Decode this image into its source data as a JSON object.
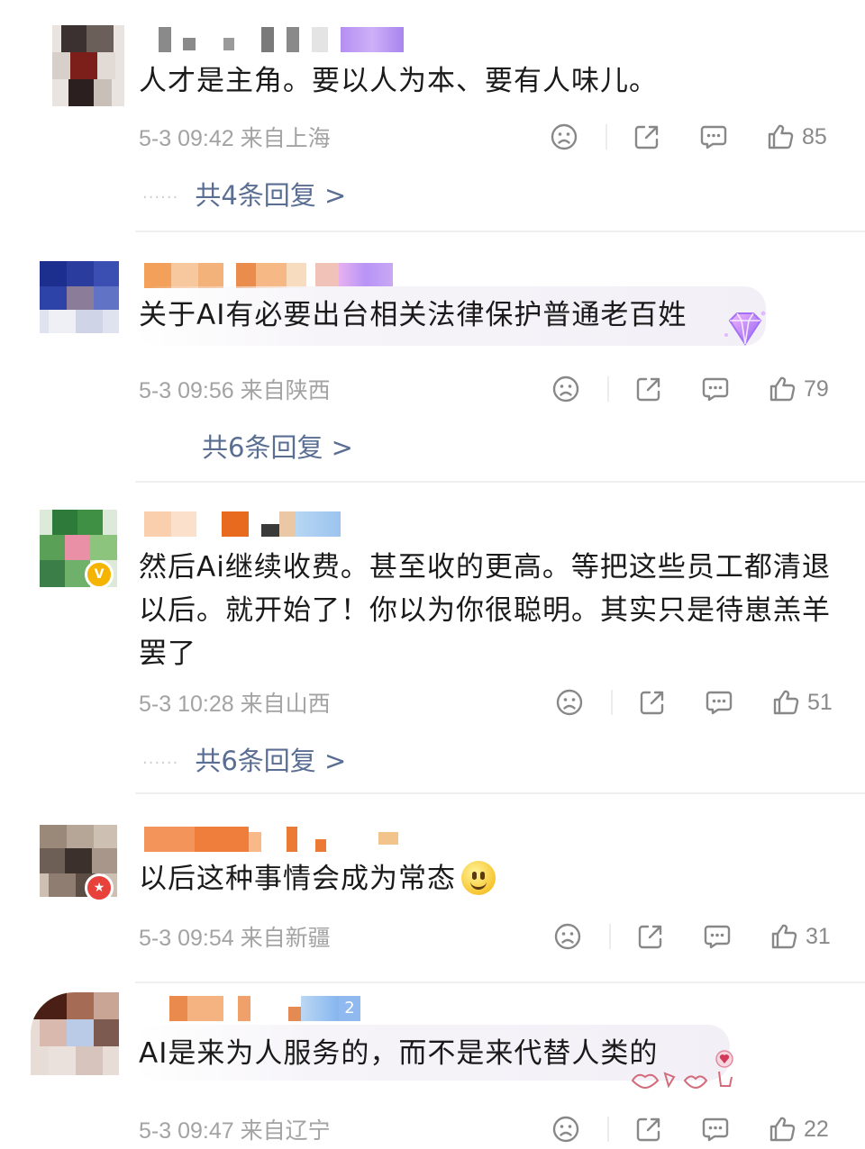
{
  "comments": [
    {
      "text": "人才是主角。要以人为本、要有人味儿。",
      "meta": "5-3 09:42  来自上海",
      "likes": "85",
      "replies": "共4条回复 >",
      "reply_dots": "······"
    },
    {
      "text": "关于AI有必要出台相关法律保护普通老百姓",
      "meta": "5-3 09:56  来自陕西",
      "likes": "79",
      "replies": "共6条回复 >",
      "reply_dots": ""
    },
    {
      "text": "然后Ai继续收费。甚至收的更高。等把这些员工都清退以后。就开始了！你以为你很聪明。其实只是待崽羔羊罢了",
      "meta": "5-3 10:28  来自山西",
      "likes": "51",
      "replies": "共6条回复 >",
      "reply_dots": "······"
    },
    {
      "text": "以后这种事情会成为常态",
      "meta": "5-3 09:54  来自新疆",
      "likes": "31"
    },
    {
      "text": "AI是来为人服务的，而不是来代替人类的",
      "meta": "5-3 09:47  来自辽宁",
      "likes": "22",
      "name_badge": "2"
    }
  ],
  "icons": {
    "dislike": "sad-face-icon",
    "share": "share-icon",
    "comment": "comment-icon",
    "like": "thumbs-up-icon"
  },
  "colors": {
    "reply_link": "#5a6e93",
    "meta": "#a3a3a3",
    "text": "#1a1a1a",
    "verified_badge": "#f5b400",
    "honor_badge": "#e8403b"
  }
}
